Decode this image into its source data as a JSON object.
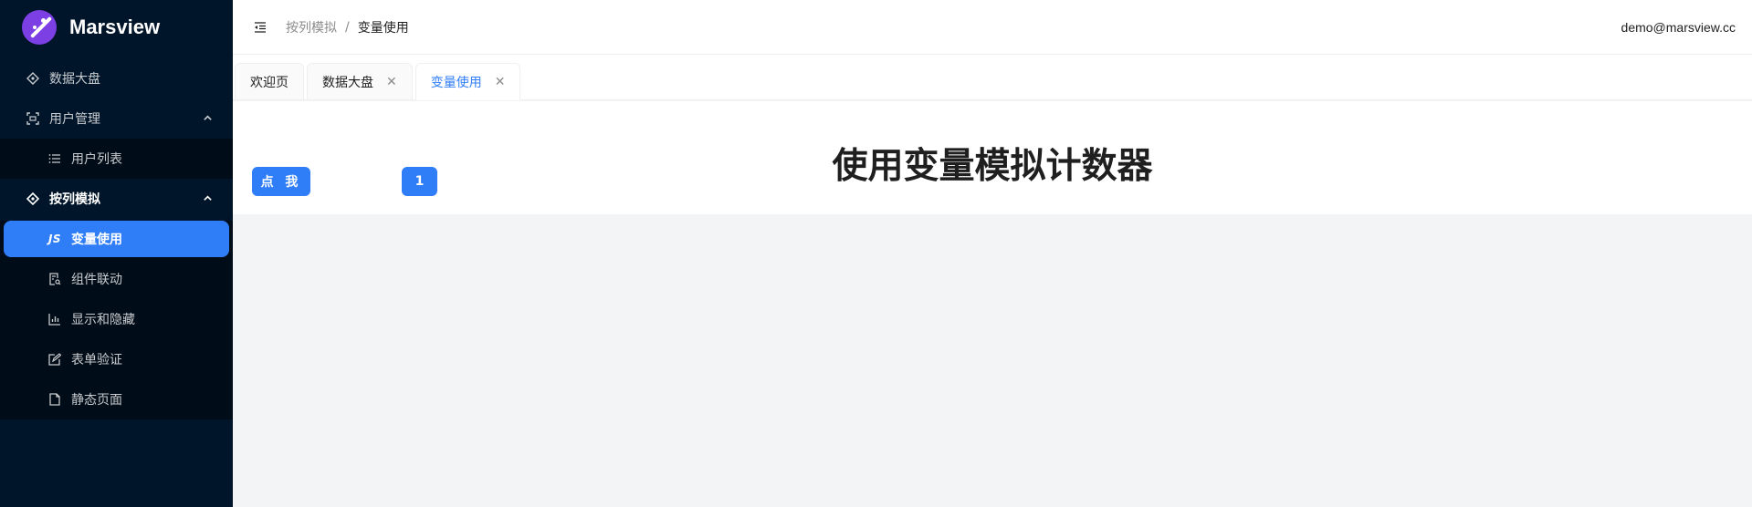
{
  "app": {
    "name": "Marsview"
  },
  "sidebar": {
    "items": [
      {
        "label": "数据大盘",
        "icon": "dashboard-icon"
      },
      {
        "label": "用户管理",
        "icon": "scan-icon",
        "expanded": true,
        "children": [
          {
            "label": "用户列表",
            "icon": "list-icon"
          }
        ]
      },
      {
        "label": "按列模拟",
        "icon": "diamond-icon",
        "expanded": true,
        "children": [
          {
            "label": "变量使用",
            "icon": "js-icon",
            "icon_text": "JS",
            "active": true
          },
          {
            "label": "组件联动",
            "icon": "file-search-icon"
          },
          {
            "label": "显示和隐藏",
            "icon": "bar-chart-icon"
          },
          {
            "label": "表单验证",
            "icon": "edit-icon"
          },
          {
            "label": "静态页面",
            "icon": "file-icon"
          }
        ]
      }
    ]
  },
  "header": {
    "breadcrumb": [
      "按列模拟",
      "变量使用"
    ],
    "breadcrumb_sep": "/",
    "user_email": "demo@marsview.cc"
  },
  "tabs": [
    {
      "label": "欢迎页",
      "closable": false
    },
    {
      "label": "数据大盘",
      "closable": true
    },
    {
      "label": "变量使用",
      "closable": true,
      "active": true
    }
  ],
  "tab_close_glyph": "✕",
  "content": {
    "click_button_label": "点 我",
    "counter_value": "1",
    "title": "使用变量模拟计数器"
  },
  "colors": {
    "sidebar_bg": "#001529",
    "primary": "#2f7ef7",
    "logo": "#7b3fe4"
  }
}
